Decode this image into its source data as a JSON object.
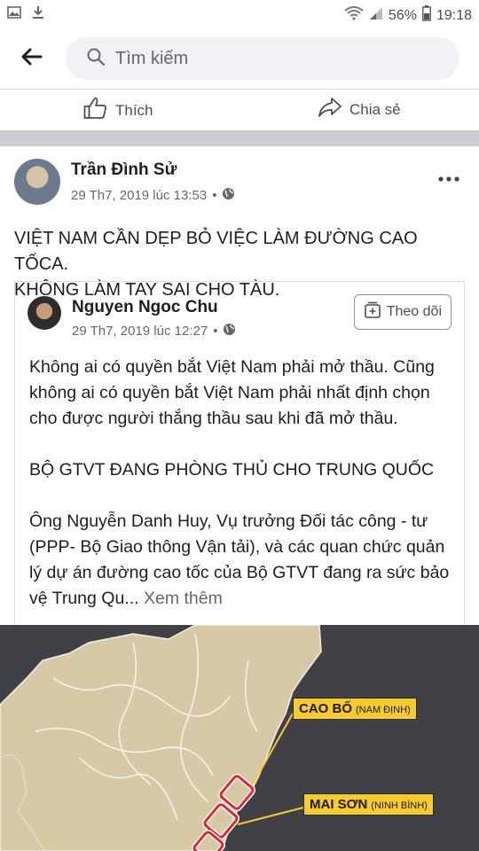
{
  "status_bar": {
    "battery_percent": "56%",
    "time": "19:18",
    "icons": [
      "image-icon",
      "download-icon",
      "wifi-icon",
      "signal-icon",
      "battery-icon"
    ]
  },
  "search": {
    "placeholder": "Tìm kiếm",
    "value": ""
  },
  "actions": {
    "like_label": "Thích",
    "share_label": "Chia sẻ"
  },
  "post": {
    "author": "Trần Đình Sử",
    "timestamp": "29 Th7, 2019 lúc 13:53",
    "separator": "•",
    "privacy": "public",
    "text": "VIỆT NAM CẦN DẸP BỎ VIỆC LÀM ĐƯỜNG CAO TỐCA.\nKHÔNG LÀM TAY SAI CHO TÀU."
  },
  "shared_post": {
    "author": "Nguyen Ngoc Chu",
    "timestamp": "29 Th7, 2019 lúc 12:27",
    "separator": "•",
    "follow_label": "Theo dõi",
    "paragraph_1": "Không ai có quyền bắt Việt Nam phải mở thầu. Cũng không ai có quyền bắt Việt Nam phải nhất định chọn cho được người thắng thầu sau khi đã mở thầu.",
    "paragraph_2": "BỘ GTVT ĐANG PHÒNG THỦ CHO TRUNG QUỐC",
    "paragraph_3": "Ông Nguyễn Danh Huy, Vụ trưởng Đối tác công - tư (PPP- Bộ Giao thông Vận tải), và các quan chức quản lý dự án đường cao tốc của Bộ GTVT đang ra sức bảo vệ Trung Qu...",
    "see_more": "Xem thêm"
  },
  "map": {
    "label_1_main": "CAO BỐ",
    "label_1_sub": "(NAM ĐỊNH)",
    "label_2_main": "MAI SƠN",
    "label_2_sub": "(NINH BÌNH)",
    "colors": {
      "background": "#3f4147",
      "land": "#d8c9a6",
      "label": "#f6cb2d",
      "route": "#e0262c"
    }
  }
}
